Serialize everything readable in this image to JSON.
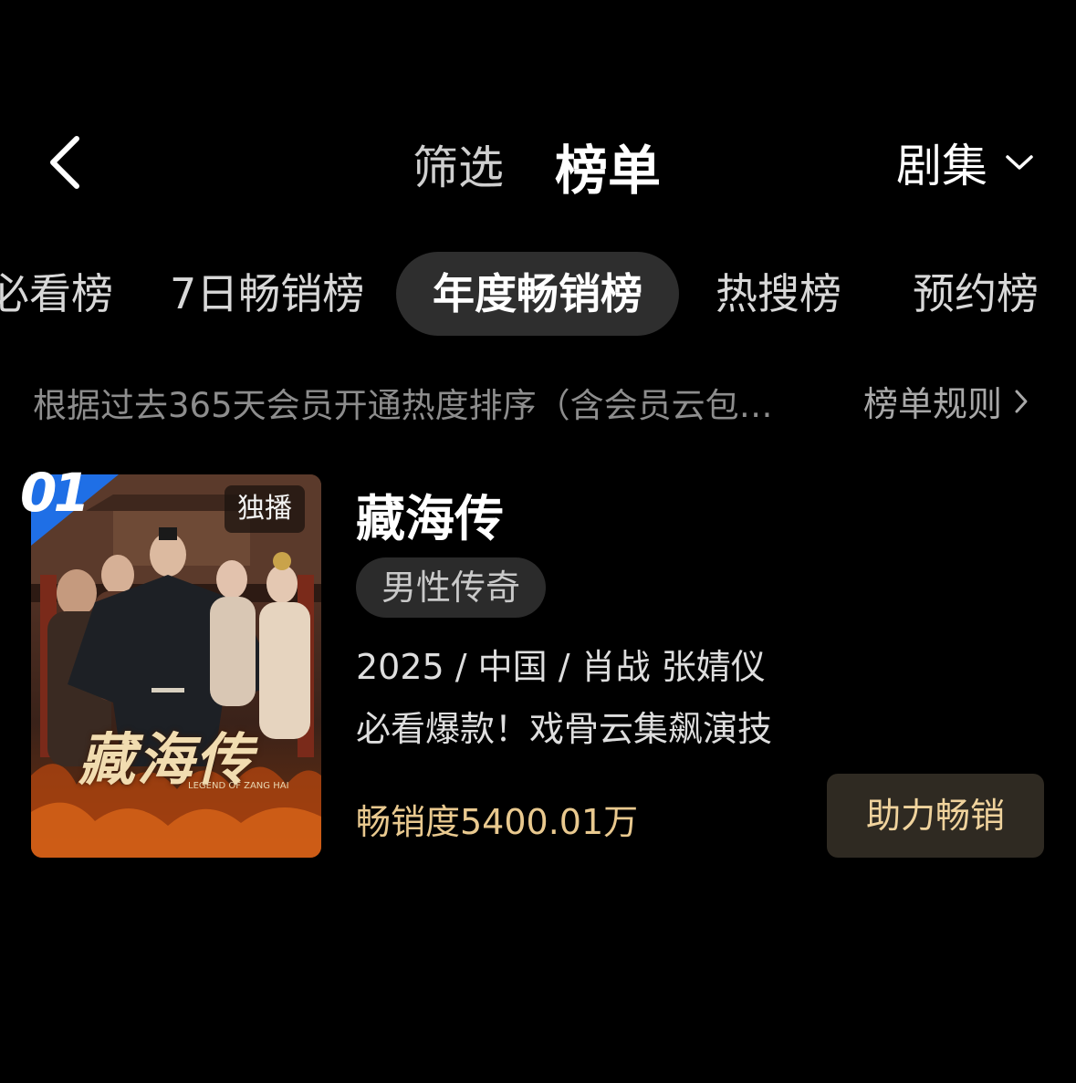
{
  "header": {
    "filter_tab": "筛选",
    "ranking_tab": "榜单",
    "type_selector": "剧集"
  },
  "chips": [
    "必看榜",
    "7日畅销榜",
    "年度畅销榜",
    "热搜榜",
    "预约榜"
  ],
  "selected_chip": "年度畅销榜",
  "rule": {
    "description": "根据过去365天会员开通热度排序（含会员云包…",
    "link": "榜单规则"
  },
  "item": {
    "rank": "01",
    "badge": "独播",
    "poster_title": "藏海传",
    "poster_subtitle": "LEGEND OF ZANG HAI",
    "title": "藏海传",
    "genre": "男性传奇",
    "meta": "2025 / 中国 / 肖战 张婧仪",
    "tagline": "必看爆款！戏骨云集飙演技",
    "sales": "畅销度5400.01万",
    "action": "助力畅销"
  },
  "colors": {
    "background": "#000000",
    "selected_chip_bg": "#2e2e2e",
    "sales_text": "#e9c98f",
    "action_bg": "#2f2a22",
    "rank_badge_blue": "#1f6fe6"
  },
  "icons": {
    "back": "chevron-left-icon",
    "dropdown": "chevron-down-icon",
    "rule_link": "chevron-right-icon"
  }
}
